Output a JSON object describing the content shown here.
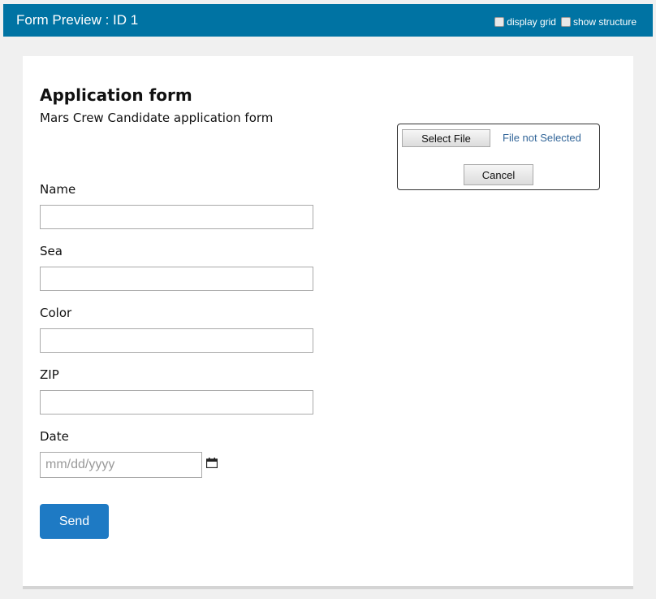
{
  "header": {
    "title": "Form Preview : ID 1",
    "options": [
      {
        "label": "display grid",
        "checked": false
      },
      {
        "label": "show structure",
        "checked": false
      }
    ]
  },
  "form": {
    "title": "Application form",
    "subtitle": "Mars Crew Candidate application form",
    "fields": [
      {
        "label": "Name",
        "value": ""
      },
      {
        "label": "Sea",
        "value": ""
      },
      {
        "label": "Color",
        "value": ""
      },
      {
        "label": "ZIP",
        "value": ""
      }
    ],
    "date": {
      "label": "Date",
      "placeholder": "mm/dd/yyyy"
    },
    "send_label": "Send",
    "file": {
      "select_label": "Select File",
      "status": "File not Selected",
      "cancel_label": "Cancel"
    }
  },
  "colors": {
    "header_bg": "#0073a3",
    "send_bg": "#1e7ac4",
    "file_status": "#336699"
  }
}
